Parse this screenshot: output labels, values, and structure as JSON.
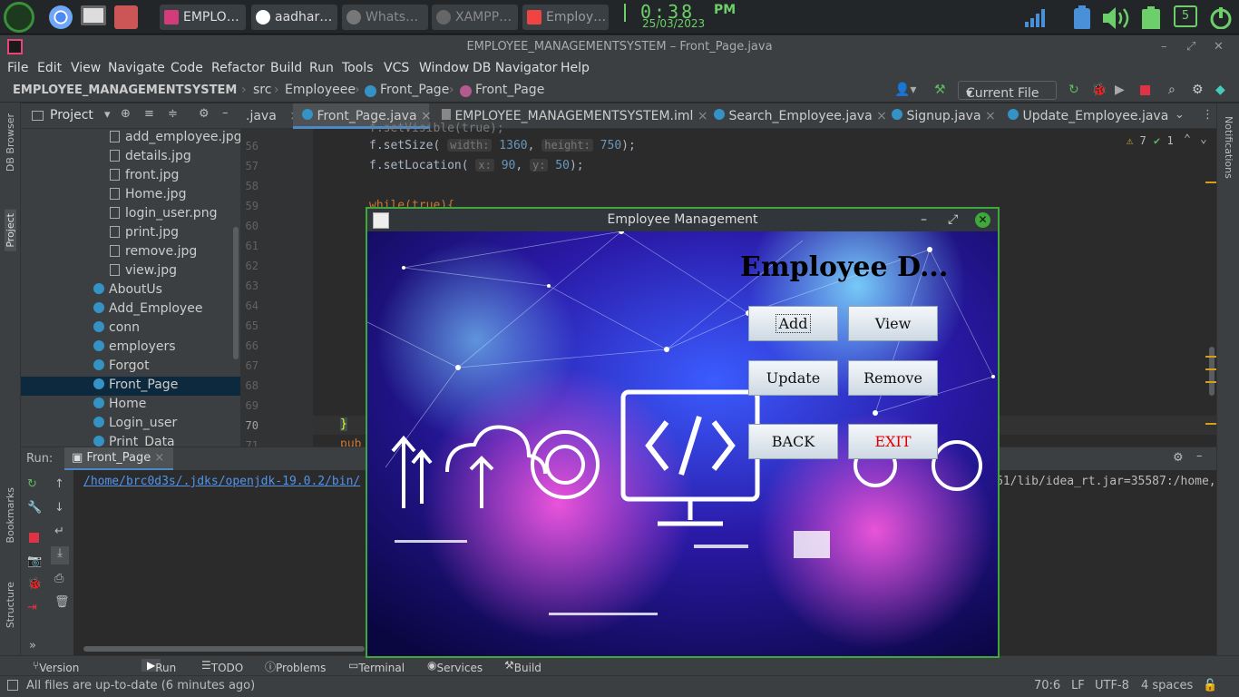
{
  "taskbar": {
    "apps": [
      {
        "label": "EMPLO…",
        "icon": "intellij-icon"
      },
      {
        "label": "aadhar…",
        "icon": "whatsapp-icon"
      },
      {
        "label": "Whats…",
        "icon": "whatsapp-icon"
      },
      {
        "label": "XAMPP…",
        "icon": "xampp-icon"
      },
      {
        "label": "Employ…",
        "icon": "java-icon"
      }
    ],
    "clock": "0:38",
    "ampm": "PM",
    "date": "25/03/2023",
    "notification_count": "5"
  },
  "ide": {
    "window_title": "EMPLOYEE_MANAGEMENTSYSTEM – Front_Page.java",
    "menu": [
      "File",
      "Edit",
      "View",
      "Navigate",
      "Code",
      "Refactor",
      "Build",
      "Run",
      "Tools",
      "VCS",
      "Window",
      "DB Navigator",
      "Help"
    ],
    "breadcrumb": {
      "project": "EMPLOYEE_MANAGEMENTSYSTEM",
      "src": "src",
      "pkg": "Employeee",
      "file": "Front_Page",
      "cls": "Front_Page"
    },
    "run_config": "Current File",
    "left_strip": {
      "db_browser": "DB Browser",
      "project": "Project",
      "bookmarks": "Bookmarks",
      "structure": "Structure"
    },
    "right_strip": {
      "notifications": "Notifications"
    },
    "project_panel": {
      "title": "Project"
    },
    "tree": {
      "files": [
        "add_employee.jpg",
        "details.jpg",
        "front.jpg",
        "Home.jpg",
        "login_user.png",
        "print.jpg",
        "remove.jpg",
        "view.jpg"
      ],
      "classes": [
        "AboutUs",
        "Add_Employee",
        "conn",
        "employers",
        "Forgot",
        "Front_Page",
        "Home",
        "Login_user",
        "Print_Data"
      ],
      "selected": "Front_Page"
    },
    "tabs": [
      ".java",
      "Front_Page.java",
      "EMPLOYEE_MANAGEMENTSYSTEM.iml",
      "Search_Employee.java",
      "Signup.java",
      "Update_Employee.java"
    ],
    "active_tab": "Front_Page.java",
    "inspections": {
      "warnings": "7",
      "ok": "1"
    },
    "line_numbers": [
      "56",
      "57",
      "58",
      "59",
      "60",
      "61",
      "62",
      "63",
      "64",
      "65",
      "66",
      "67",
      "68",
      "69",
      "70",
      "71"
    ],
    "code": {
      "top_partial": "f.setVisible(true);",
      "line56_pre": "f.setSize(",
      "line56_h1": "width:",
      "line56_v1": "1360",
      "line56_h2": "height:",
      "line56_v2": "750",
      "line56_post": ");",
      "line57_pre": "f.setLocation(",
      "line57_h1": "x:",
      "line57_v1": "90",
      "line57_h2": "y:",
      "line57_v2": "50",
      "line57_post": ");",
      "line59": "while(true){",
      "line70": "}",
      "line71": "pub"
    },
    "run_panel": {
      "label": "Run:",
      "config": "Front_Page",
      "output_left": "/home/brc0d3s/.jdks/openjdk-19.0.2/bin/",
      "output_right": "61/lib/idea_rt.jar=35587:/home,"
    },
    "bottom_tools": [
      "Version Control",
      "Run",
      "TODO",
      "Problems",
      "Terminal",
      "Services",
      "Build"
    ],
    "status": {
      "message": "All files are up-to-date (6 minutes ago)",
      "position": "70:6",
      "line_sep": "LF",
      "encoding": "UTF-8",
      "indent": "4 spaces"
    }
  },
  "swing": {
    "title": "Employee Management",
    "heading": "Employee D...",
    "buttons": {
      "add": "Add",
      "view": "View",
      "update": "Update",
      "remove": "Remove",
      "back": "BACK",
      "exit": "EXIT"
    },
    "exit_color": "#e00000",
    "border_color": "#3fa83a"
  }
}
